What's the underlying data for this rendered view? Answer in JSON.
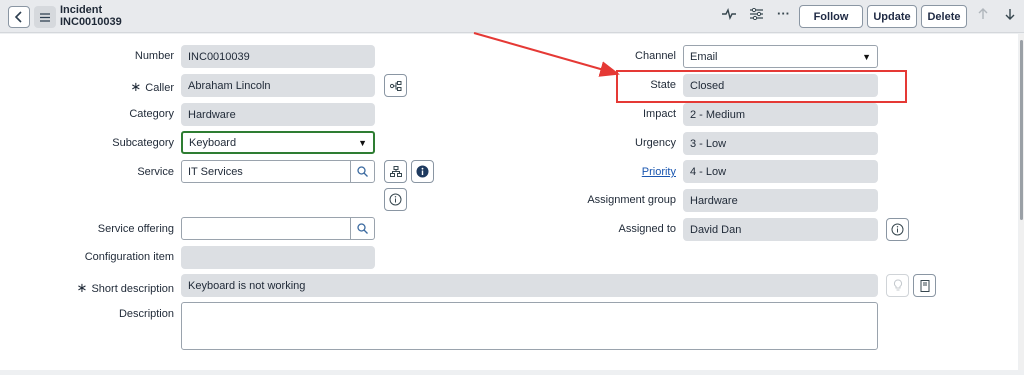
{
  "header": {
    "record_type": "Incident",
    "record_number": "INC0010039",
    "follow_label": "Follow",
    "update_label": "Update",
    "delete_label": "Delete"
  },
  "form": {
    "left": {
      "number": {
        "label": "Number",
        "value": "INC0010039"
      },
      "caller": {
        "label": "Caller",
        "value": "Abraham Lincoln",
        "required": true
      },
      "category": {
        "label": "Category",
        "value": "Hardware"
      },
      "subcategory": {
        "label": "Subcategory",
        "value": "Keyboard"
      },
      "service": {
        "label": "Service",
        "value": "IT Services"
      },
      "service_offering": {
        "label": "Service offering",
        "value": ""
      },
      "configuration_item": {
        "label": "Configuration item",
        "value": ""
      },
      "short_description": {
        "label": "Short description",
        "value": "Keyboard is not working",
        "required": true
      },
      "description": {
        "label": "Description",
        "value": ""
      }
    },
    "right": {
      "channel": {
        "label": "Channel",
        "value": "Email"
      },
      "state": {
        "label": "State",
        "value": "Closed"
      },
      "impact": {
        "label": "Impact",
        "value": "2 - Medium"
      },
      "urgency": {
        "label": "Urgency",
        "value": "3 - Low"
      },
      "priority": {
        "label": "Priority",
        "value": "4 - Low"
      },
      "assignment_group": {
        "label": "Assignment group",
        "value": "Hardware"
      },
      "assigned_to": {
        "label": "Assigned to",
        "value": "David Dan"
      }
    }
  },
  "annotation": {
    "color": "#e53935"
  },
  "colors": {
    "readonly_field": "#dcdfe3",
    "subcategory_focus": "#2e7d32",
    "link": "#1a56b0"
  }
}
